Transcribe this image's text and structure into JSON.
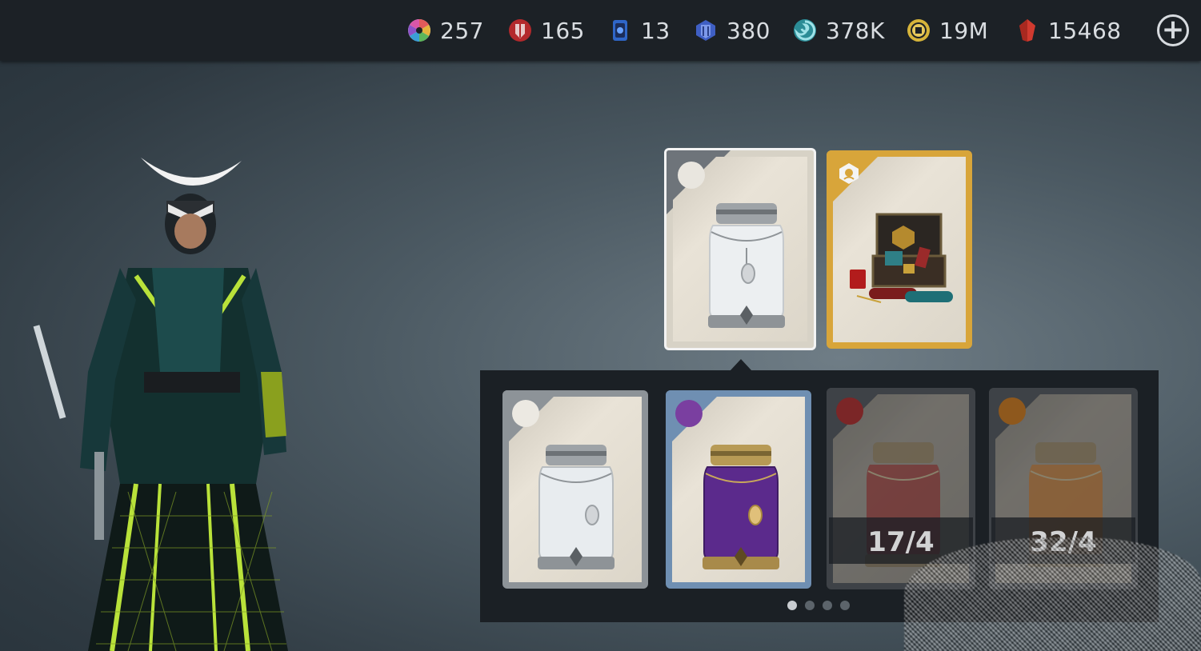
{
  "currencies": [
    {
      "name": "color-wheel",
      "value": "257",
      "color": "#e05a5a"
    },
    {
      "name": "red-shield",
      "value": "165",
      "color": "#c4373a"
    },
    {
      "name": "blue-card",
      "value": "13",
      "color": "#3a78d6"
    },
    {
      "name": "blue-gem",
      "value": "380",
      "color": "#4a6fd0"
    },
    {
      "name": "teal-swirl",
      "value": "378K",
      "color": "#3fa6b0"
    },
    {
      "name": "gold-coin",
      "value": "19M",
      "color": "#d6b43a"
    },
    {
      "name": "red-crystal",
      "value": "15468",
      "color": "#d03a2f"
    }
  ],
  "top_cards": [
    {
      "name": "white-jar-card",
      "selected": true,
      "rarity_color": "#e9e6df"
    },
    {
      "name": "treasure-chest-card",
      "selected": false,
      "rarity_color": "#d8a53a"
    }
  ],
  "jar_cards": [
    {
      "name": "white-jar",
      "rarity_color": "#ece9e2",
      "liquid": "#e8ecef",
      "progress": ""
    },
    {
      "name": "purple-jar",
      "rarity_color": "#7a3fa0",
      "liquid": "#5b2a8c",
      "progress": ""
    },
    {
      "name": "red-jar",
      "rarity_color": "#8c2828",
      "liquid": "#8a2424",
      "progress": "17/4"
    },
    {
      "name": "orange-jar",
      "rarity_color": "#a3621c",
      "liquid": "#b0641e",
      "progress": "32/4"
    }
  ],
  "pagination": {
    "total": 4,
    "active": 1
  },
  "icons": {
    "add": "plus-circle-icon"
  }
}
